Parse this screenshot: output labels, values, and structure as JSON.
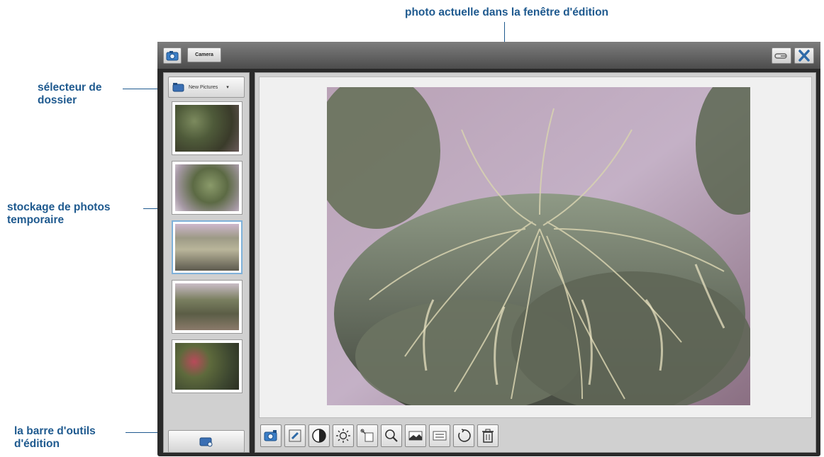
{
  "annotations": {
    "current_photo": "photo actuelle dans la fenêtre d'édition",
    "folder_selector_line1": "sélecteur de",
    "folder_selector_line2": "dossier",
    "temp_storage_line1": "stockage de photos",
    "temp_storage_line2": "temporaire",
    "toolbar_line1": "la barre d'outils",
    "toolbar_line2": "d'édition"
  },
  "titlebar": {
    "camera_label": "Camera",
    "icons": [
      "camera-icon",
      "key-icon",
      "close-icon"
    ]
  },
  "sidebar": {
    "folder_selector_label": "New Pictures",
    "selected_thumbnail_index": 2,
    "thumbnail_count": 5
  },
  "toolbar": {
    "tools": [
      "camera-icon",
      "pencil-icon",
      "contrast-icon",
      "brightness-icon",
      "crop-icon",
      "zoom-icon",
      "landscape-icon",
      "resize-icon",
      "rotate-icon",
      "trash-icon"
    ]
  },
  "colors": {
    "annotation": "#1f5a8f",
    "selection": "#7fb1d9",
    "titlebar": "#5a5a5a"
  }
}
